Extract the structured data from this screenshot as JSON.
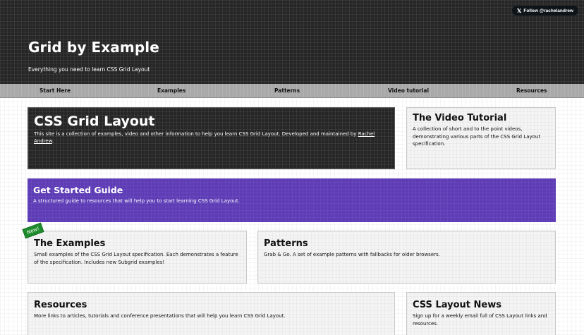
{
  "header": {
    "follow_label": "Follow @rachelandrew",
    "title": "Grid by Example",
    "tagline": "Everything you need to learn CSS Grid Layout"
  },
  "nav": {
    "items": [
      {
        "label": "Start Here"
      },
      {
        "label": "Examples"
      },
      {
        "label": "Patterns"
      },
      {
        "label": "Video tutorial"
      },
      {
        "label": "Resources"
      }
    ]
  },
  "hero": {
    "title": "CSS Grid Layout",
    "text": "This site is a collection of examples, video and other information to help you learn CSS Grid Layout. Developed and maintained by",
    "author_link": "Rachel Andrew",
    "text_end": "."
  },
  "video": {
    "title": "The Video Tutorial",
    "text": "A collection of short and to the point videos, demonstrating various parts of the CSS Grid Layout specification."
  },
  "guide": {
    "title": "Get Started Guide",
    "text": "A structured guide to resources that will help you to start learning CSS Grid Layout."
  },
  "examples": {
    "badge": "New!",
    "title": "The Examples",
    "text": "Small examples of the CSS Grid Layout specification. Each demonstrates a feature of the specification. Includes new Subgrid examples!"
  },
  "patterns": {
    "title": "Patterns",
    "text": "Grab & Go. A set of example patterns with fallbacks for older browsers."
  },
  "resources": {
    "title": "Resources",
    "text": "More links to articles, tutorials and conference presentations that will help you learn CSS Grid Layout."
  },
  "news": {
    "title": "CSS Layout News",
    "text": "Sign up for a weekly email full of CSS Layout links and resources."
  },
  "colors": {
    "header_bg": "#262626",
    "nav_bg": "#a9a9a9",
    "guide_bg": "#5e3cb6",
    "badge_bg": "#1e8c2c"
  },
  "icons": {
    "follow": "x-logo-icon"
  }
}
